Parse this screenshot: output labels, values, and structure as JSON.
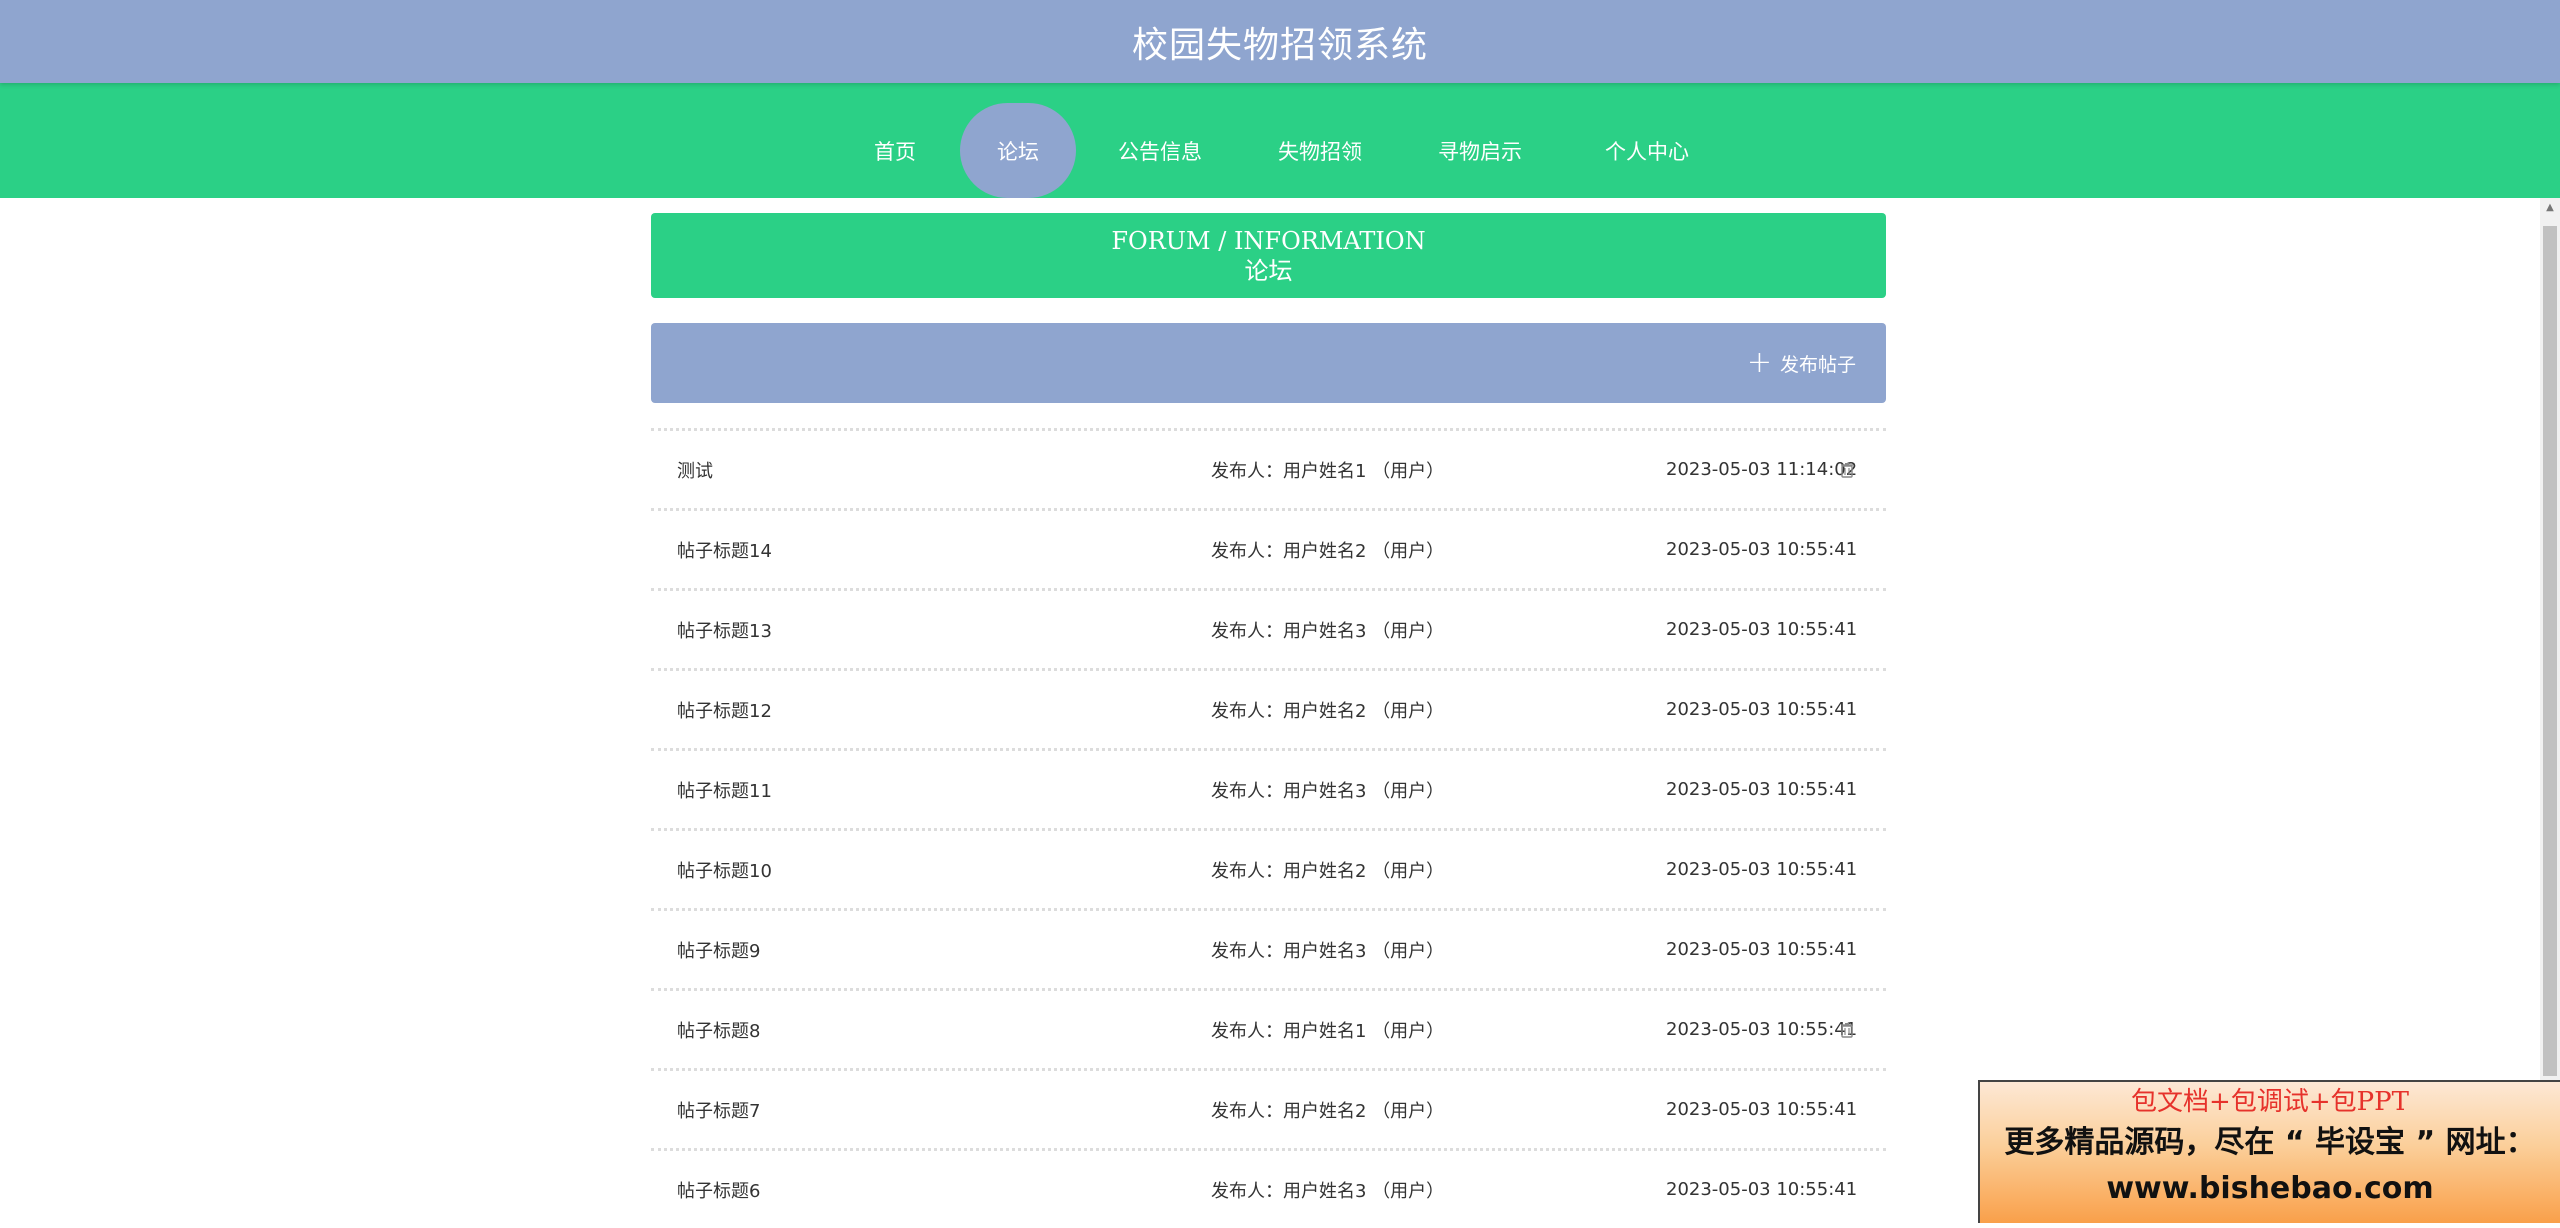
{
  "site": {
    "title": "校园失物招领系统"
  },
  "nav": {
    "items": [
      {
        "label": "首页"
      },
      {
        "label": "论坛"
      },
      {
        "label": "公告信息"
      },
      {
        "label": "失物招领"
      },
      {
        "label": "寻物启示"
      },
      {
        "label": "个人中心"
      }
    ],
    "active_index": 1
  },
  "banner": {
    "en": "FORUM / INFORMATION",
    "cn": "论坛"
  },
  "toolbar": {
    "post_button_label": "发布帖子"
  },
  "posts": [
    {
      "title": "测试",
      "author": "发布人：用户姓名1 （用户）",
      "time": "2023-05-03 11:14:02",
      "deletable": true
    },
    {
      "title": "帖子标题14",
      "author": "发布人：用户姓名2 （用户）",
      "time": "2023-05-03 10:55:41",
      "deletable": false
    },
    {
      "title": "帖子标题13",
      "author": "发布人：用户姓名3 （用户）",
      "time": "2023-05-03 10:55:41",
      "deletable": false
    },
    {
      "title": "帖子标题12",
      "author": "发布人：用户姓名2 （用户）",
      "time": "2023-05-03 10:55:41",
      "deletable": false
    },
    {
      "title": "帖子标题11",
      "author": "发布人：用户姓名3 （用户）",
      "time": "2023-05-03 10:55:41",
      "deletable": false
    },
    {
      "title": "帖子标题10",
      "author": "发布人：用户姓名2 （用户）",
      "time": "2023-05-03 10:55:41",
      "deletable": false
    },
    {
      "title": "帖子标题9",
      "author": "发布人：用户姓名3 （用户）",
      "time": "2023-05-03 10:55:41",
      "deletable": false
    },
    {
      "title": "帖子标题8",
      "author": "发布人：用户姓名1 （用户）",
      "time": "2023-05-03 10:55:41",
      "deletable": true
    },
    {
      "title": "帖子标题7",
      "author": "发布人：用户姓名2 （用户）",
      "time": "2023-05-03 10:55:41",
      "deletable": false
    },
    {
      "title": "帖子标题6",
      "author": "发布人：用户姓名3 （用户）",
      "time": "2023-05-03 10:55:41",
      "deletable": false
    }
  ],
  "promo": {
    "line1": "包文档+包调试+包PPT",
    "line2": "更多精品源码，尽在 “ 毕设宝 ” 网址：",
    "line3": "www.bishebao.com"
  },
  "colors": {
    "header": "#8fa5cf",
    "nav": "#2bd086",
    "accent": "#8fa5cf"
  }
}
